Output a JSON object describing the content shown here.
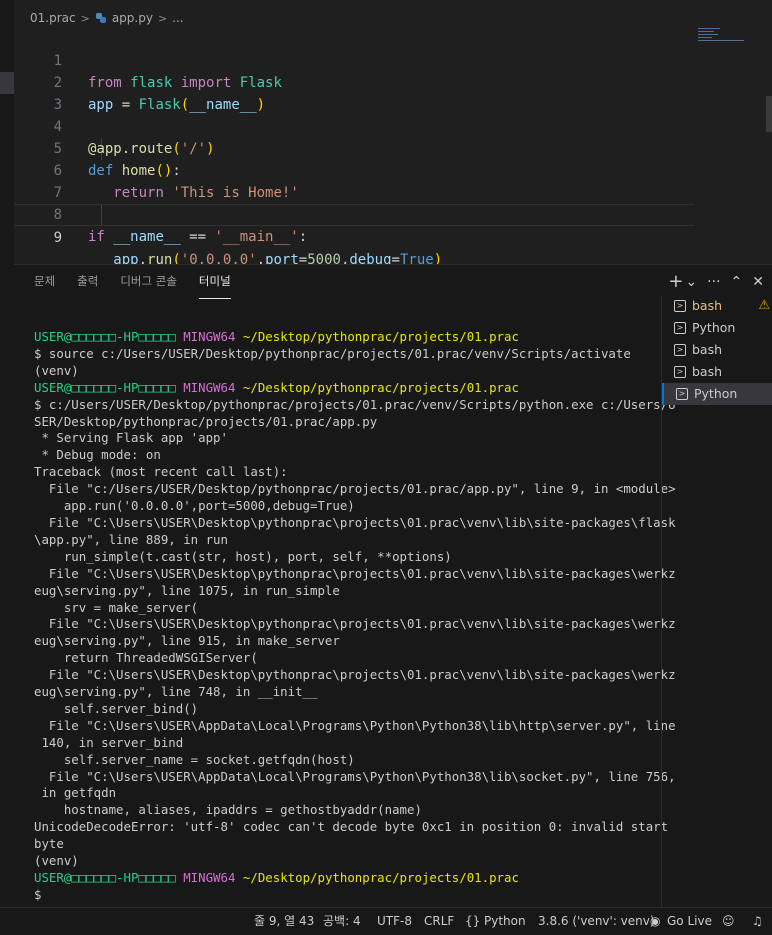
{
  "breadcrumb": {
    "folder": "01.prac",
    "file": "app.py",
    "more": "..."
  },
  "editor": {
    "lines": [
      {
        "n": "1"
      },
      {
        "n": "2"
      },
      {
        "n": "3"
      },
      {
        "n": "4"
      },
      {
        "n": "5"
      },
      {
        "n": "6"
      },
      {
        "n": "7"
      },
      {
        "n": "8"
      },
      {
        "n": "9"
      }
    ],
    "code": {
      "l1": {
        "from": "from",
        "module": "flask",
        "import": "import",
        "name": "Flask"
      },
      "l2": {
        "var": "app",
        "eq": " = ",
        "cls": "Flask",
        "open": "(",
        "arg": "__name__",
        "close": ")"
      },
      "l4": {
        "at": "@",
        "obj": "app",
        "dot": ".",
        "fn": "route",
        "open": "(",
        "str": "'/'",
        "close": ")"
      },
      "l5": {
        "def": "def",
        "fn": "home",
        "paren": "()",
        "colon": ":"
      },
      "l6": {
        "ret": "return",
        "str": "'This is Home!'"
      },
      "l8": {
        "if": "if",
        "name": "__name__",
        "op": " == ",
        "str": "'__main__'",
        "colon": ":"
      },
      "l9": {
        "obj": "app",
        "dot": ".",
        "fn": "run",
        "open": "(",
        "str": "'0.0.0.0'",
        "c1": ",",
        "port": "port",
        "eq1": "=",
        "portval": "5000",
        "c2": ",",
        "debug": "debug",
        "eq2": "=",
        "debugval": "True",
        "close": ")"
      }
    }
  },
  "panel": {
    "tabs": [
      "문제",
      "출력",
      "디버그 콘솔",
      "터미널"
    ],
    "actions": {
      "plus": "+",
      "chevron": "⌄",
      "more": "···",
      "up": "⌃",
      "close": "✕"
    }
  },
  "terminal": {
    "prompt1": {
      "user": "USER@□□□□□□-HP□□□□□",
      "ming": "MINGW64",
      "path": "~/Desktop/pythonprac/projects/01.prac"
    },
    "cmd1": "$ source c:/Users/USER/Desktop/pythonprac/projects/01.prac/venv/Scripts/activate",
    "venv1": "(venv)",
    "prompt2": {
      "user": "USER@□□□□□□-HP□□□□□",
      "ming": "MINGW64",
      "path": "~/Desktop/pythonprac/projects/01.prac"
    },
    "output": [
      "$ c:/Users/USER/Desktop/pythonprac/projects/01.prac/venv/Scripts/python.exe c:/Users/U",
      "SER/Desktop/pythonprac/projects/01.prac/app.py",
      " * Serving Flask app 'app'",
      " * Debug mode: on",
      "Traceback (most recent call last):",
      "  File \"c:/Users/USER/Desktop/pythonprac/projects/01.prac/app.py\", line 9, in <module>",
      "    app.run('0.0.0.0',port=5000,debug=True)",
      "  File \"C:\\Users\\USER\\Desktop\\pythonprac\\projects\\01.prac\\venv\\lib\\site-packages\\flask",
      "\\app.py\", line 889, in run",
      "    run_simple(t.cast(str, host), port, self, **options)",
      "  File \"C:\\Users\\USER\\Desktop\\pythonprac\\projects\\01.prac\\venv\\lib\\site-packages\\werkz",
      "eug\\serving.py\", line 1075, in run_simple",
      "    srv = make_server(",
      "  File \"C:\\Users\\USER\\Desktop\\pythonprac\\projects\\01.prac\\venv\\lib\\site-packages\\werkz",
      "eug\\serving.py\", line 915, in make_server",
      "    return ThreadedWSGIServer(",
      "  File \"C:\\Users\\USER\\Desktop\\pythonprac\\projects\\01.prac\\venv\\lib\\site-packages\\werkz",
      "eug\\serving.py\", line 748, in __init__",
      "    self.server_bind()",
      "  File \"C:\\Users\\USER\\AppData\\Local\\Programs\\Python\\Python38\\lib\\http\\server.py\", line",
      " 140, in server_bind",
      "    self.server_name = socket.getfqdn(host)",
      "  File \"C:\\Users\\USER\\AppData\\Local\\Programs\\Python\\Python38\\lib\\socket.py\", line 756,",
      " in getfqdn",
      "    hostname, aliases, ipaddrs = gethostbyaddr(name)",
      "UnicodeDecodeError: 'utf-8' codec can't decode byte 0xc1 in position 0: invalid start",
      "byte",
      "(venv)"
    ],
    "prompt3": {
      "user": "USER@□□□□□□-HP□□□□□",
      "ming": "MINGW64",
      "path": "~/Desktop/pythonprac/projects/01.prac"
    },
    "final": "$"
  },
  "terminal_list": [
    {
      "label": "bash",
      "warn": "⚠"
    },
    {
      "label": "Python"
    },
    {
      "label": "bash"
    },
    {
      "label": "bash"
    },
    {
      "label": "Python"
    }
  ],
  "statusbar": {
    "position": "줄 9, 열 43",
    "spaces": "공백: 4",
    "encoding": "UTF-8",
    "eol": "CRLF",
    "language": "Python",
    "interpreter": "3.8.6 ('venv': venv)",
    "golive": "Go Live"
  },
  "colors": {
    "keyword": "#c586c0",
    "class": "#4ec9b0",
    "string": "#ce9178",
    "terminal_user": "#23d18b",
    "terminal_mingw": "#d670d6",
    "terminal_path": "#e5e510",
    "accent": "#0078d4"
  },
  "icons": {
    "breadcrumb_file": "python-file-icon",
    "terminal_item": "terminal-icon",
    "warning": "warning-icon"
  }
}
